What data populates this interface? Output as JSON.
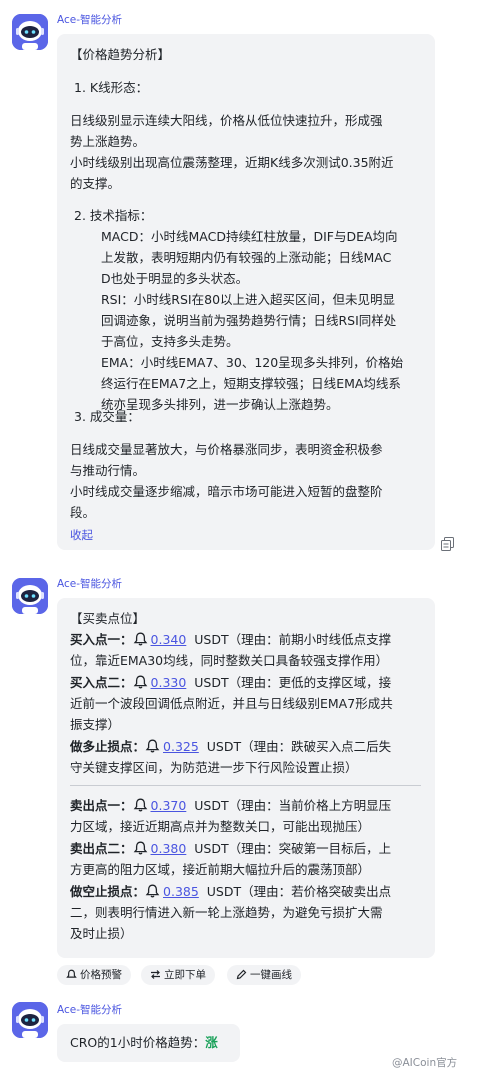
{
  "assistant_name": "Ace-智能分析",
  "msg1": {
    "title": "【价格趋势分析】",
    "s1_head": "1. K线形态：",
    "s1_lines": [
      "日线级别显示连续大阳线，价格从低位快速拉升，形成强",
      "势上涨趋势。",
      "小时线级别出现高位震荡整理，近期K线多次测试0.35附近",
      "的支撑。"
    ],
    "s2_head": "2. 技术指标：",
    "s2_lines": [
      "MACD：小时线MACD持续红柱放量，DIF与DEA均向",
      "上发散，表明短期内仍有较强的上涨动能；日线MAC",
      "D也处于明显的多头状态。",
      "RSI：小时线RSI在80以上进入超买区间，但未见明显",
      "回调迹象，说明当前为强势趋势行情；日线RSI同样处",
      "于高位，支持多头走势。",
      "EMA：小时线EMA7、30、120呈现多头排列，价格始",
      "终运行在EMA7之上，短期支撑较强；日线EMA均线系",
      "统亦呈现多头排列，进一步确认上涨趋势。"
    ],
    "s3_head": "3. 成交量：",
    "s3_lines": [
      "日线成交量显著放大，与价格暴涨同步，表明资金积极参",
      "与推动行情。",
      "小时线成交量逐步缩减，暗示市场可能进入短暂的盘整阶",
      "段。"
    ],
    "collapse": "收起"
  },
  "msg2": {
    "title": "【买卖点位】",
    "unit": "USDT",
    "points": [
      {
        "label": "买入点一：",
        "price": "0.340",
        "reason1": "（理由：前期小时线低点支撑",
        "reason2": "位，靠近EMA30均线，同时整数关口具备较强支撑作用）"
      },
      {
        "label": "买入点二：",
        "price": "0.330",
        "reason1": "（理由：更低的支撑区域，接",
        "reason2": "近前一个波段回调低点附近，并且与日线级别EMA7形成共",
        "reason3": "振支撑）"
      },
      {
        "label": "做多止损点：",
        "price": "0.325",
        "reason1": "（理由：跌破买入点二后失",
        "reason2": "守关键支撑区间，为防范进一步下行风险设置止损）"
      },
      {
        "label": "卖出点一：",
        "price": "0.370",
        "reason1": "（理由：当前价格上方明显压",
        "reason2": "力区域，接近近期高点并为整数关口，可能出现抛压）"
      },
      {
        "label": "卖出点二：",
        "price": "0.380",
        "reason1": "（理由：突破第一目标后，上",
        "reason2": "方更高的阻力区域，接近前期大幅拉升后的震荡顶部）"
      },
      {
        "label": "做空止损点：",
        "price": "0.385",
        "reason1": "（理由：若价格突破卖出点",
        "reason2": "二，则表明行情进入新一轮上涨趋势，为避免亏损扩大需",
        "reason3": "及时止损）"
      }
    ],
    "chips": [
      "价格预警",
      "立即下单",
      "一键画线"
    ]
  },
  "msg3": {
    "text": "CRO的1小时价格趋势：",
    "trend": "涨"
  },
  "watermark": "@AICoin官方",
  "colors": {
    "accent": "#4a55e0",
    "bubble": "#f2f3f5",
    "up": "#18a058"
  }
}
